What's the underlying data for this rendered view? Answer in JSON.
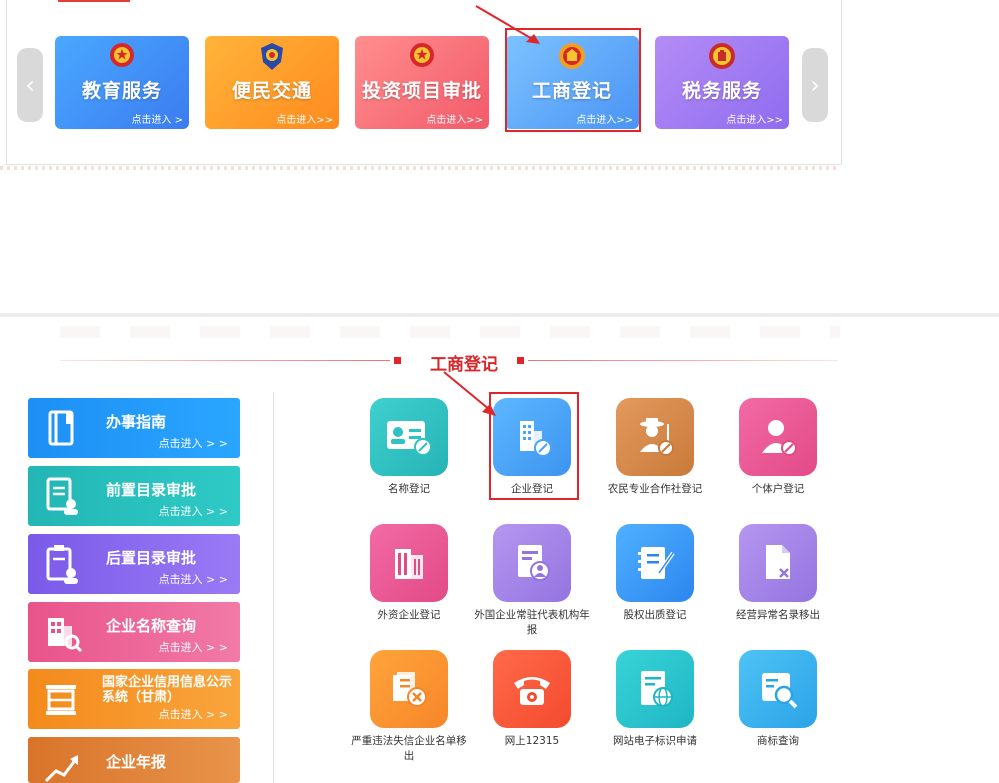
{
  "carousel": {
    "prev_arrow": "‹",
    "next_arrow": "›",
    "cards": [
      {
        "title": "教育服务",
        "enter": "点击进入 >",
        "icon": "national-emblem-icon"
      },
      {
        "title": "便民交通",
        "enter": "点击进入>>",
        "icon": "police-badge-icon"
      },
      {
        "title": "投资项目审批",
        "enter": "点击进入>>",
        "icon": "national-emblem-icon"
      },
      {
        "title": "工商登记",
        "enter": "点击进入>>",
        "icon": "business-badge-icon",
        "highlighted": true
      },
      {
        "title": "税务服务",
        "enter": "点击进入>>",
        "icon": "tax-badge-icon"
      }
    ]
  },
  "section": {
    "title": "工商登记"
  },
  "sidebar": {
    "items": [
      {
        "title": "办事指南",
        "enter": "点击进入 > >",
        "icon": "book-icon",
        "color": "#1d8ff5"
      },
      {
        "title": "前置目录审批",
        "enter": "点击进入 > >",
        "icon": "document-user-icon",
        "color": "#22b6b4"
      },
      {
        "title": "后置目录审批",
        "enter": "点击进入 > >",
        "icon": "clipboard-user-icon",
        "color": "#7a5ae8"
      },
      {
        "title": "企业名称查询",
        "enter": "点击进入 > >",
        "icon": "building-search-icon",
        "color": "#e8548a"
      },
      {
        "title": "国家企业信用信息公示系统（甘肃）",
        "enter": "点击进入 > >",
        "icon": "table-icon",
        "color": "#f48a1c"
      },
      {
        "title": "企业年报",
        "enter": "",
        "icon": "trend-chart-icon",
        "color": "#d8742a"
      }
    ]
  },
  "functions": [
    {
      "label": "名称登记",
      "icon": "id-card-edit-icon",
      "color": "#2fc2c2"
    },
    {
      "label": "企业登记",
      "icon": "building-edit-icon",
      "color": "#4aa4f7",
      "highlighted": true
    },
    {
      "label": "农民专业合作社登记",
      "icon": "farmer-edit-icon",
      "color": "#d88a4a"
    },
    {
      "label": "个体户登记",
      "icon": "person-edit-icon",
      "color": "#ec5a96"
    },
    {
      "label": "外资企业登记",
      "icon": "skyscraper-icon",
      "color": "#ec5a96"
    },
    {
      "label": "外国企业常驻代表机构年报",
      "icon": "document-person-icon",
      "color": "#a585e8"
    },
    {
      "label": "股权出质登记",
      "icon": "notebook-pen-icon",
      "color": "#3d9af2"
    },
    {
      "label": "经营异常名录移出",
      "icon": "document-remove-icon",
      "color": "#a585e8"
    },
    {
      "label": "严重违法失信企业名单移出",
      "icon": "document-cancel-icon",
      "color": "#f7952f"
    },
    {
      "label": "网上12315",
      "icon": "telephone-icon",
      "color": "#f45a3a"
    },
    {
      "label": "网站电子标识申请",
      "icon": "document-globe-icon",
      "color": "#2cc4cf"
    },
    {
      "label": "商标查询",
      "icon": "document-search-icon",
      "color": "#3bb2ee"
    }
  ]
}
